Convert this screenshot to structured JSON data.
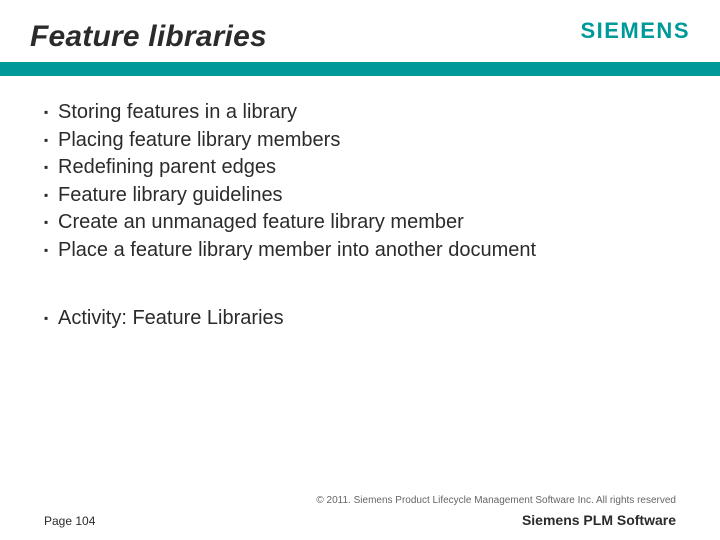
{
  "header": {
    "title": "Feature libraries",
    "logo_text": "SIEMENS"
  },
  "bullets1": [
    "Storing features in a library",
    "Placing feature library members",
    "Redefining parent edges",
    "Feature library guidelines",
    "Create an unmanaged feature library member",
    "Place a feature library member into another document"
  ],
  "bullets2": [
    "Activity: Feature Libraries"
  ],
  "footer": {
    "copyright": "© 2011. Siemens Product Lifecycle Management Software Inc. All rights reserved",
    "page": "Page 104",
    "brand": "Siemens PLM Software"
  }
}
